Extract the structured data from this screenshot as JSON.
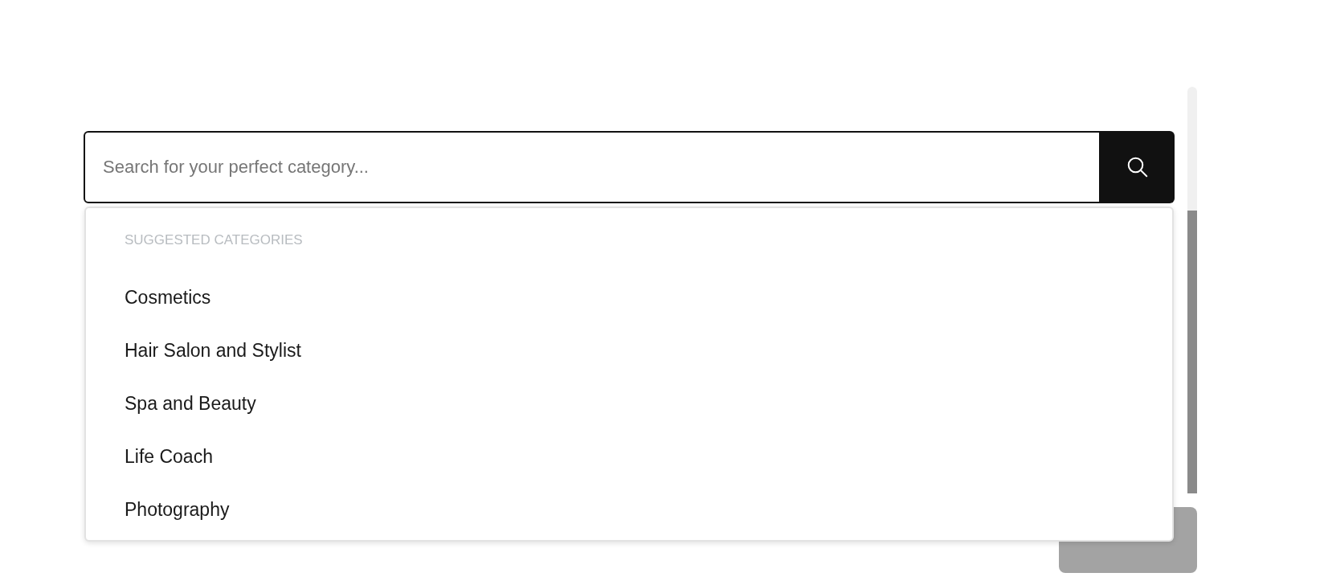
{
  "search": {
    "placeholder": "Search for your perfect category..."
  },
  "suggestions": {
    "heading": "SUGGESTED CATEGORIES",
    "items": [
      {
        "label": "Cosmetics"
      },
      {
        "label": "Hair Salon and Stylist"
      },
      {
        "label": "Spa and Beauty"
      },
      {
        "label": "Life Coach"
      },
      {
        "label": "Photography"
      }
    ]
  },
  "continue_button": {
    "disabled": true
  }
}
